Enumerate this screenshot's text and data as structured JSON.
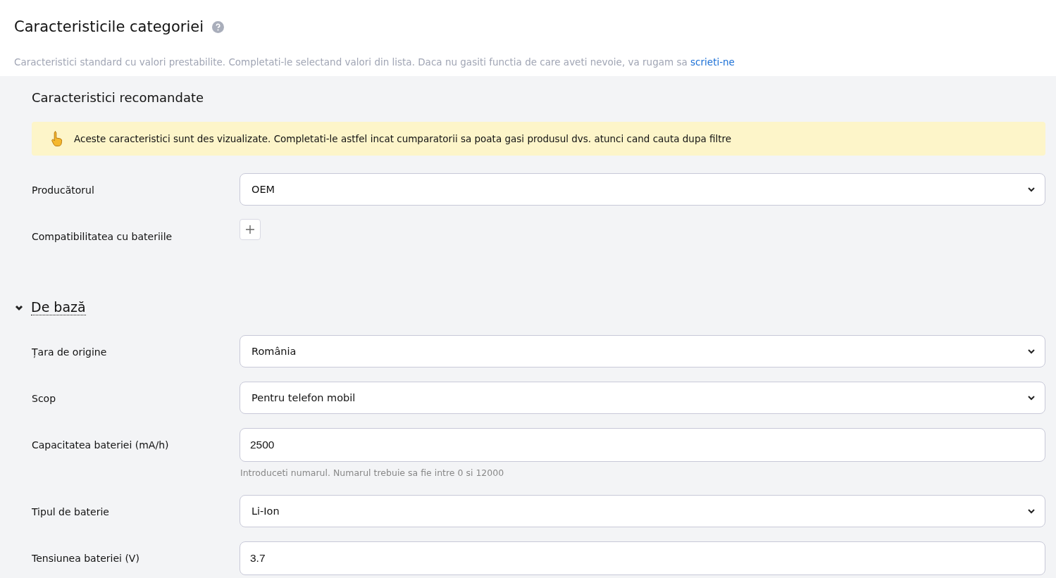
{
  "header": {
    "title": "Caracteristicile categoriei",
    "description": "Caracteristici standard cu valori prestabilite. Completati-le selectand valori din lista. Daca nu gasiti functia de care aveti nevoie, va rugam sa",
    "link": "scrieti-ne"
  },
  "recommended": {
    "title": "Caracteristici recomandate",
    "notice": "Aceste caracteristici sunt des vizualizate. Completati-le astfel incat cumparatorii sa poata gasi produsul dvs. atunci cand cauta dupa filtre",
    "fields": [
      {
        "label": "Producătorul",
        "kind": "select",
        "value": "OEM"
      },
      {
        "label": "Compatibilitatea cu bateriile",
        "kind": "add"
      }
    ]
  },
  "basic": {
    "title": "De bază",
    "expanded": true,
    "fields": [
      {
        "label": "Țara de origine",
        "kind": "select",
        "value": "România"
      },
      {
        "label": "Scop",
        "kind": "select",
        "value": "Pentru telefon mobil"
      },
      {
        "label": "Capacitatea bateriei (mA/h)",
        "kind": "input",
        "value": "2500",
        "hint": "Introduceti numarul. Numarul trebuie sa fie intre 0 si 12000"
      },
      {
        "label": "Tipul de baterie",
        "kind": "select",
        "value": "Li-Ion"
      },
      {
        "label": "Tensiunea bateriei (V)",
        "kind": "input",
        "value": "3.7"
      }
    ]
  }
}
